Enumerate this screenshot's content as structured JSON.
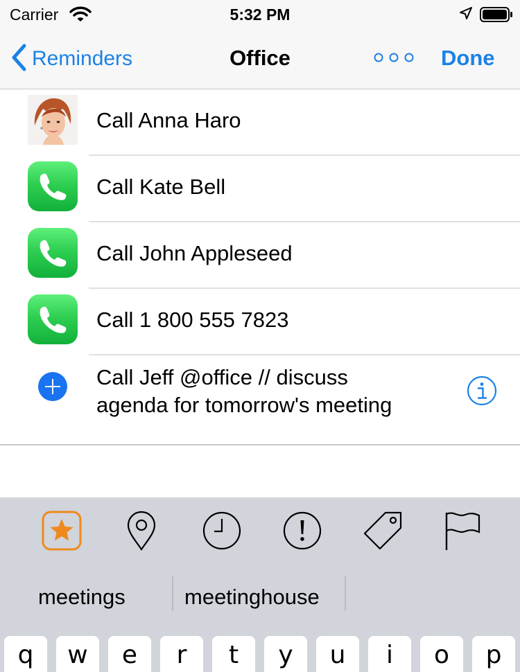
{
  "status_bar": {
    "carrier": "Carrier",
    "time": "5:32 PM"
  },
  "nav": {
    "back_label": "Reminders",
    "title": "Office",
    "done_label": "Done"
  },
  "reminders": [
    {
      "label": "Call Anna Haro",
      "icon": "avatar-photo"
    },
    {
      "label": "Call Kate Bell",
      "icon": "phone-icon"
    },
    {
      "label": "Call John Appleseed",
      "icon": "phone-icon"
    },
    {
      "label": "Call 1 800 555 7823",
      "icon": "phone-icon"
    }
  ],
  "new_reminder": {
    "text_line1": "Call Jeff @office // discuss",
    "text_line2": "agenda for tomorrow's meeting"
  },
  "toolbar": {
    "icons": [
      "star-icon",
      "location-pin-icon",
      "clock-icon",
      "priority-icon",
      "tag-icon",
      "flag-icon"
    ]
  },
  "suggestions": [
    "meetings",
    "meetinghouse"
  ],
  "keyboard": {
    "row1": [
      "q",
      "w",
      "e",
      "r",
      "t",
      "y",
      "u",
      "i",
      "o",
      "p"
    ]
  },
  "colors": {
    "accent": "#1a82e7",
    "plus": "#1a73f0",
    "star": "#f0891d",
    "keyboard_bg": "#d1d4da",
    "phone_green": "#2fcf52"
  }
}
